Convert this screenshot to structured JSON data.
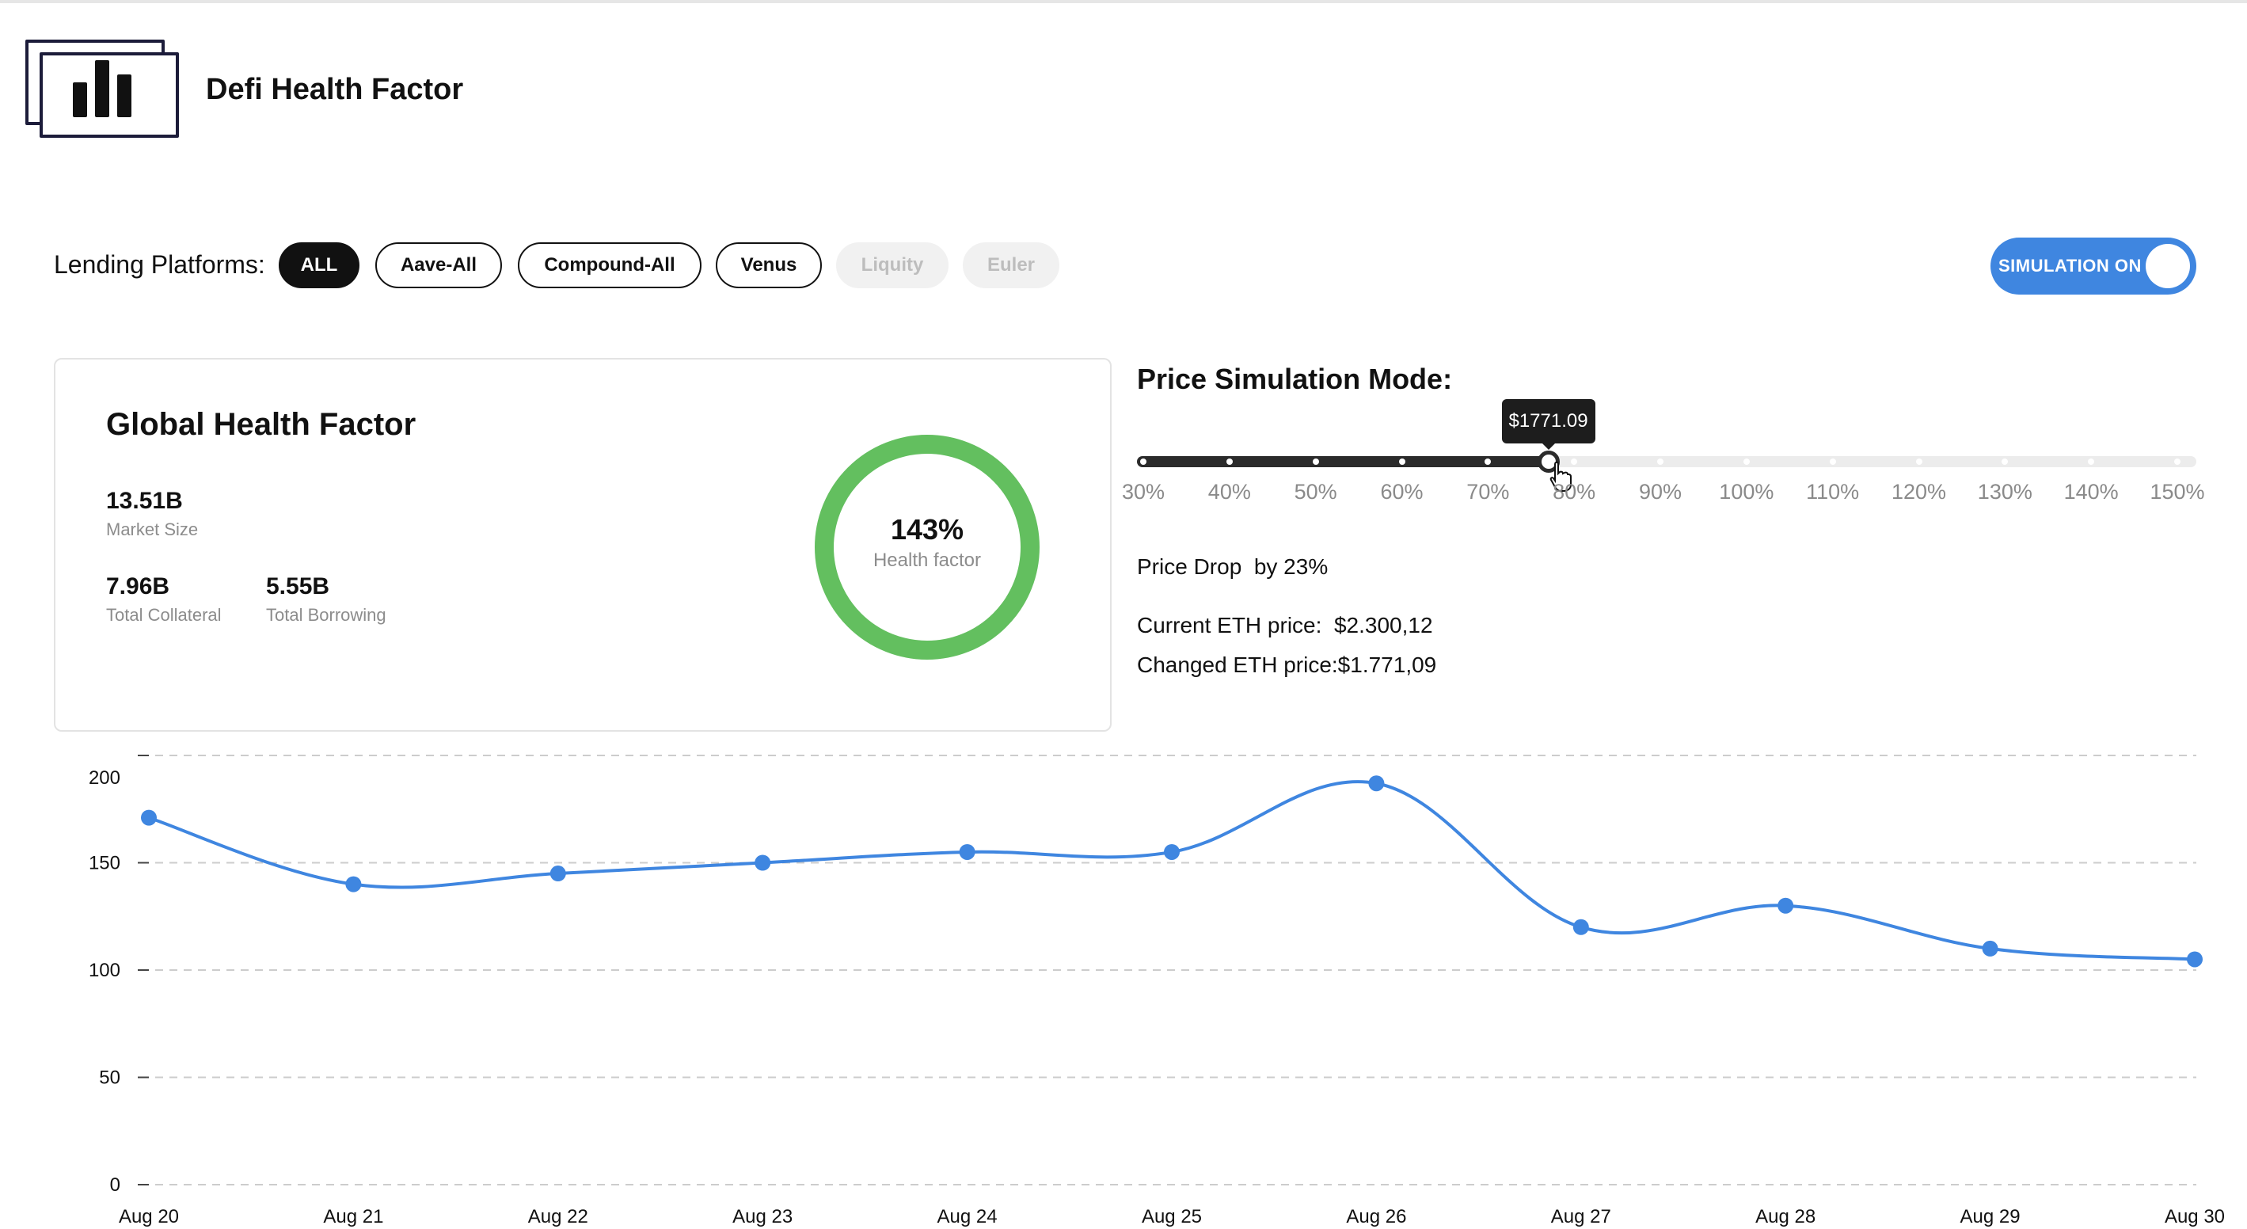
{
  "app": {
    "title": "Defi Health Factor",
    "logo_icon": "bar-chart-icon"
  },
  "filters": {
    "label": "Lending Platforms:",
    "platforms": [
      {
        "label": "ALL",
        "state": "active"
      },
      {
        "label": "Aave-All",
        "state": "normal"
      },
      {
        "label": "Compound-All",
        "state": "normal"
      },
      {
        "label": "Venus",
        "state": "normal"
      },
      {
        "label": "Liquity",
        "state": "disabled"
      },
      {
        "label": "Euler",
        "state": "disabled"
      }
    ]
  },
  "simulation_toggle": {
    "label": "SIMULATION ON",
    "on": true,
    "color": "#3f86e0"
  },
  "health_card": {
    "title": "Global Health Factor",
    "market_size": {
      "value": "13.51B",
      "label": "Market Size"
    },
    "total_collateral": {
      "value": "7.96B",
      "label": "Total Collateral"
    },
    "total_borrowing": {
      "value": "5.55B",
      "label": "Total Borrowing"
    },
    "health_factor": {
      "value": "143%",
      "label": "Health factor",
      "color": "#63bf5f"
    }
  },
  "simulation": {
    "title": "Price Simulation Mode:",
    "tooltip": "$1771.09",
    "slider_marks": [
      "30%",
      "40%",
      "50%",
      "60%",
      "70%",
      "80%",
      "90%",
      "100%",
      "110%",
      "120%",
      "130%",
      "140%",
      "150%"
    ],
    "slider_value_percent": 77,
    "price_drop": "Price Drop  by 23%",
    "current_price": "Current ETH price:  $2.300,12",
    "changed_price": "Changed ETH price:$1.771,09"
  },
  "chart_data": {
    "type": "line",
    "categories": [
      "Aug 20",
      "Aug 21",
      "Aug 22",
      "Aug 23",
      "Aug 24",
      "Aug 25",
      "Aug 26",
      "Aug 27",
      "Aug 28",
      "Aug 29",
      "Aug 30"
    ],
    "values": [
      171,
      140,
      145,
      150,
      155,
      155,
      187,
      120,
      130,
      110,
      105
    ],
    "y_ticks": [
      "0",
      "50",
      "100",
      "150",
      "200"
    ],
    "ylim": [
      0,
      200
    ],
    "grid": "dashed horizontal",
    "color": "#3f86e0"
  }
}
